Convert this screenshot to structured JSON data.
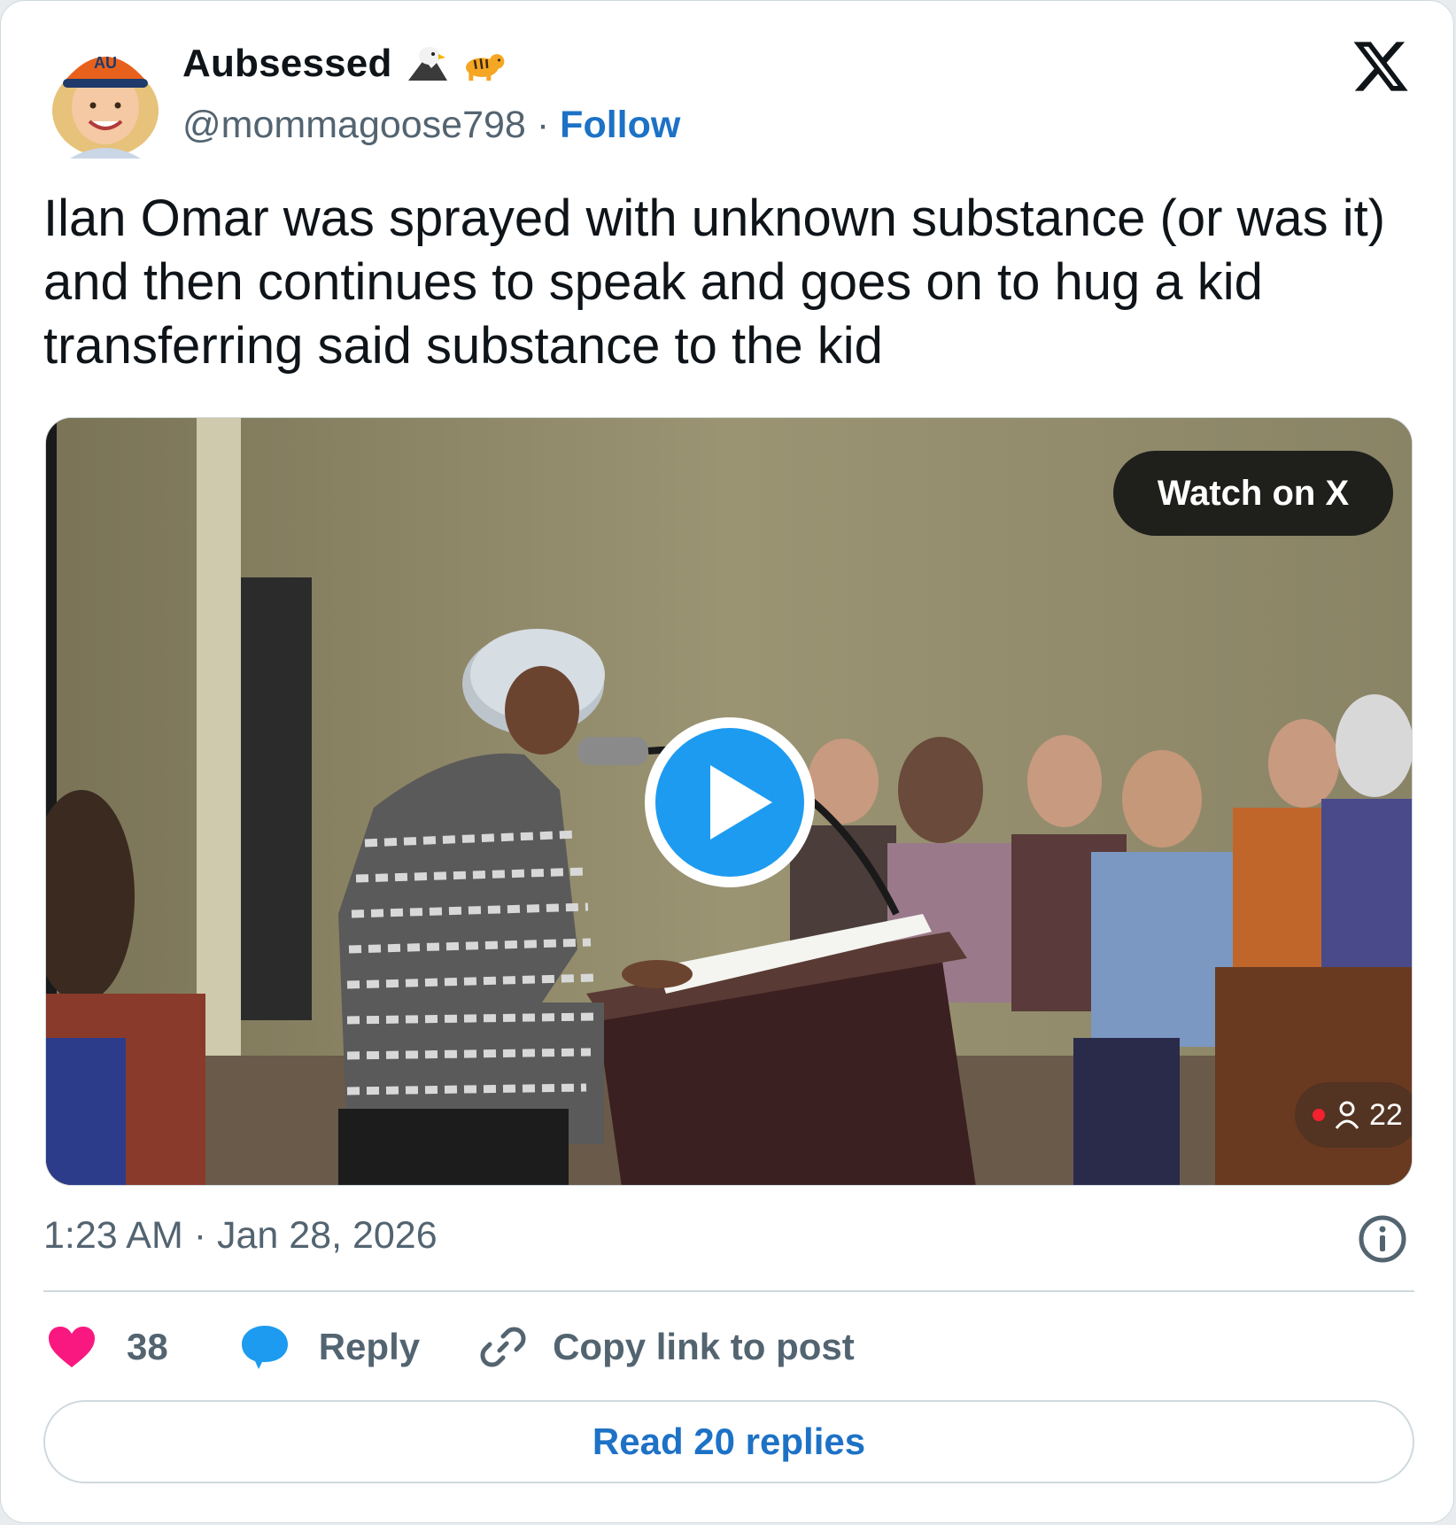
{
  "colors": {
    "accent": "#1d72c6",
    "text_primary": "#0f1419",
    "text_secondary": "#536471",
    "like": "#f91880",
    "reply": "#1d9bf0",
    "border": "#cfd9de",
    "live": "#f4212e"
  },
  "author": {
    "display_name": "Aubsessed",
    "emojis": [
      "eagle-emoji",
      "tiger-emoji"
    ],
    "handle": "@mommagoose798",
    "separator": "·",
    "follow_label": "Follow",
    "avatar_icon": "avatar-image"
  },
  "header": {
    "logo_icon": "x-logo-icon"
  },
  "tweet": {
    "text": "Ilan Omar was sprayed with unknown substance (or was it) and then continues to speak and goes on to hug a kid transferring said substance to the kid"
  },
  "media": {
    "watch_label": "Watch on X",
    "play_icon": "play-icon",
    "viewer_icon": "person-icon",
    "viewer_count": "22"
  },
  "meta": {
    "timestamp": "1:23 AM · Jan 28, 2026",
    "info_icon": "info-icon"
  },
  "actions": {
    "like_icon": "heart-icon",
    "like_count": "38",
    "reply_icon": "speech-bubble-icon",
    "reply_label": "Reply",
    "copy_icon": "link-icon",
    "copy_label": "Copy link to post"
  },
  "footer": {
    "read_replies_label": "Read 20 replies"
  }
}
